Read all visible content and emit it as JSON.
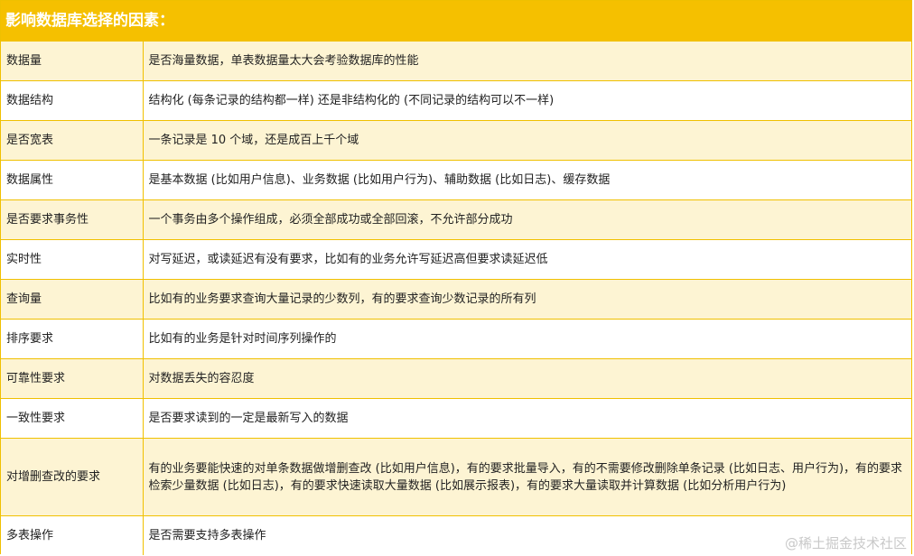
{
  "title": "影响数据库选择的因素：",
  "rows": [
    {
      "factor": "数据量",
      "description": "是否海量数据，单表数据量太大会考验数据库的性能"
    },
    {
      "factor": "数据结构",
      "description": "结构化 (每条记录的结构都一样) 还是非结构化的 (不同记录的结构可以不一样)"
    },
    {
      "factor": "是否宽表",
      "description": "一条记录是 10 个域，还是成百上千个域"
    },
    {
      "factor": "数据属性",
      "description": "是基本数据 (比如用户信息)、业务数据 (比如用户行为)、辅助数据 (比如日志)、缓存数据"
    },
    {
      "factor": "是否要求事务性",
      "description": "一个事务由多个操作组成，必须全部成功或全部回滚，不允许部分成功"
    },
    {
      "factor": "实时性",
      "description": "对写延迟，或读延迟有没有要求，比如有的业务允许写延迟高但要求读延迟低"
    },
    {
      "factor": "查询量",
      "description": "比如有的业务要求查询大量记录的少数列，有的要求查询少数记录的所有列"
    },
    {
      "factor": "排序要求",
      "description": "比如有的业务是针对时间序列操作的"
    },
    {
      "factor": "可靠性要求",
      "description": "对数据丢失的容忍度"
    },
    {
      "factor": "一致性要求",
      "description": "是否要求读到的一定是最新写入的数据"
    },
    {
      "factor": "对增删查改的要求",
      "description": "有的业务要能快速的对单条数据做增删查改 (比如用户信息)，有的要求批量导入，有的不需要修改删除单条记录 (比如日志、用户行为)，有的要求检索少量数据 (比如日志)，有的要求快速读取大量数据 (比如展示报表)，有的要求大量读取并计算数据 (比如分析用户行为)"
    },
    {
      "factor": "多表操作",
      "description": "是否需要支持多表操作"
    }
  ],
  "watermark": "@稀土掘金技术社区",
  "colors": {
    "header_bg": "#f5c000",
    "border": "#f0c000",
    "row_alt_bg": "#fdf4d3",
    "row_bg": "#ffffff"
  }
}
